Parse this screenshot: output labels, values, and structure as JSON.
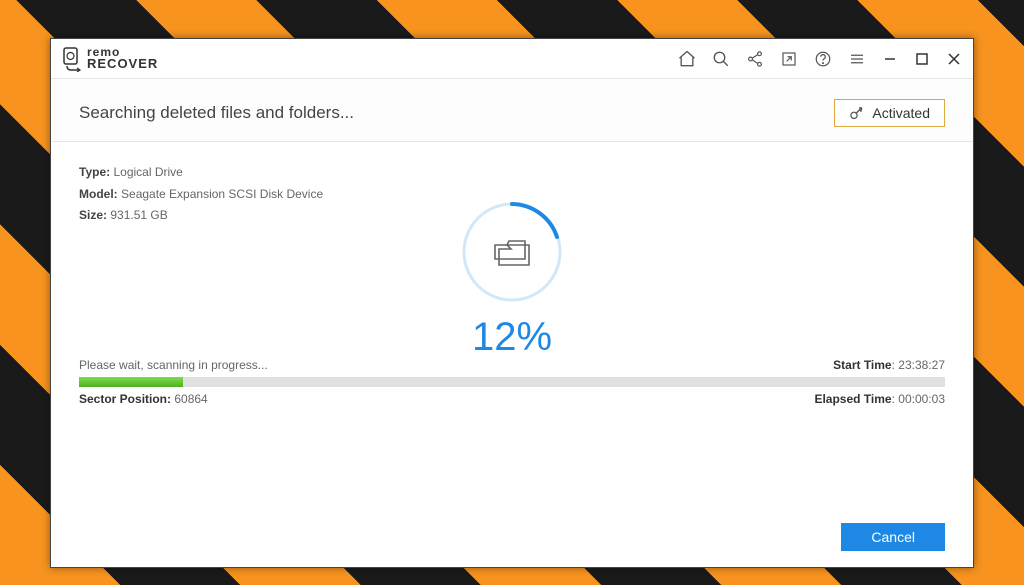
{
  "app": {
    "name_top": "remo",
    "name_bot": "RECOVER"
  },
  "header": {
    "title": "Searching deleted files and folders...",
    "activated_label": "Activated"
  },
  "drive": {
    "type_label": "Type:",
    "type_value": "Logical Drive",
    "model_label": "Model:",
    "model_value": "Seagate Expansion SCSI Disk Device",
    "size_label": "Size:",
    "size_value": "931.51 GB"
  },
  "progress": {
    "percent_text": "12%",
    "percent_value": 12,
    "wait_text": "Please wait, scanning in progress...",
    "start_time_label": "Start Time",
    "start_time_value": ": 23:38:27",
    "sector_label": "Sector Position:",
    "sector_value": " 60864",
    "elapsed_label": "Elapsed Time",
    "elapsed_value": ": 00:00:03"
  },
  "buttons": {
    "cancel": "Cancel"
  }
}
